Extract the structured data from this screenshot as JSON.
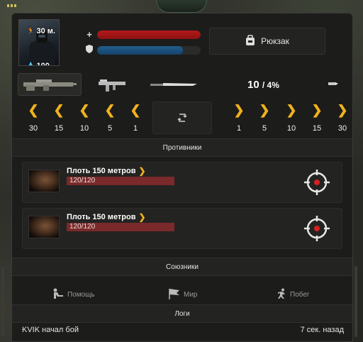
{
  "player": {
    "distance": "30 м.",
    "water": "100",
    "hp_level": 1.0,
    "armor_level": 0.83
  },
  "backpack": {
    "label": "Рюкзак"
  },
  "weapons": {
    "ammo": "10",
    "ammo_suffix": "/ 4%"
  },
  "movement": {
    "back": [
      "30",
      "15",
      "10",
      "5",
      "1"
    ],
    "forward": [
      "1",
      "5",
      "10",
      "15",
      "30"
    ]
  },
  "sections": {
    "enemies": "Противники",
    "allies": "Союзники",
    "logs": "Логи"
  },
  "enemies": [
    {
      "name": "Плоть 150 метров",
      "hp": "120/120"
    },
    {
      "name": "Плоть 150 метров",
      "hp": "120/120"
    }
  ],
  "actions": {
    "help": "Помощь",
    "peace": "Мир",
    "escape": "Побег"
  },
  "log": {
    "message": "KVIK начал бой",
    "time": "7 сек. назад"
  },
  "colors": {
    "accent": "#f0b21c",
    "hp": "#b3191a",
    "armor": "#1f5d8e",
    "target": "#d42020"
  }
}
